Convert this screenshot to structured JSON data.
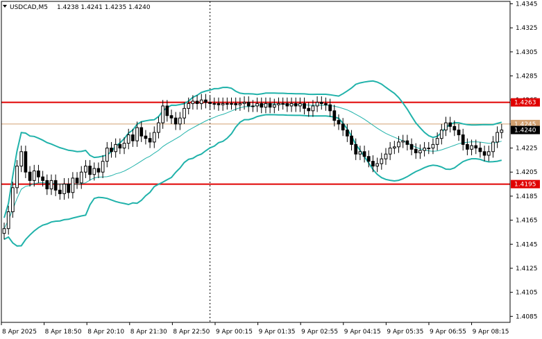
{
  "header": {
    "symbol": "USDCAD,M5",
    "ohlc": "1.4238 1.4241 1.4235 1.4240"
  },
  "colors": {
    "candle": "#000000",
    "band": "#20b2aa",
    "ma": "#20b2aa",
    "resistance": "#e00000",
    "current_line": "#d2a070",
    "axis": "#000000",
    "background": "#ffffff"
  },
  "chart_data": {
    "type": "candlestick",
    "symbol": "USDCAD",
    "timeframe": "M5",
    "ylim": [
      1.408,
      1.4347
    ],
    "y_ticks": [
      "1.4345",
      "1.4325",
      "1.4305",
      "1.4285",
      "1.4265",
      "1.4245",
      "1.4225",
      "1.4205",
      "1.4185",
      "1.4165",
      "1.4145",
      "1.4125",
      "1.4105",
      "1.4085"
    ],
    "x_ticks": [
      "8 Apr 2025",
      "8 Apr 18:50",
      "8 Apr 20:10",
      "8 Apr 21:30",
      "8 Apr 22:50",
      "9 Apr 00:15",
      "9 Apr 01:35",
      "9 Apr 02:55",
      "9 Apr 04:15",
      "9 Apr 05:35",
      "9 Apr 06:55",
      "9 Apr 08:15"
    ],
    "horizontal_levels": [
      {
        "value": 1.4263,
        "label": "1.4263",
        "color": "#e00000"
      },
      {
        "value": 1.4195,
        "label": "1.4195",
        "color": "#e00000"
      }
    ],
    "current_price": {
      "value": 1.424,
      "label": "1.4240"
    },
    "secondary_price": {
      "value": 1.4245,
      "label": "1.4245"
    },
    "vertical_marker_index": 48,
    "close": [
      1.4158,
      1.4172,
      1.4192,
      1.421,
      1.4222,
      1.4205,
      1.4198,
      1.4206,
      1.4201,
      1.4198,
      1.4191,
      1.4198,
      1.419,
      1.4187,
      1.4195,
      1.4188,
      1.42,
      1.4196,
      1.4205,
      1.421,
      1.4203,
      1.4208,
      1.4205,
      1.4214,
      1.4225,
      1.4222,
      1.4228,
      1.4225,
      1.4229,
      1.4236,
      1.4231,
      1.4242,
      1.4235,
      1.4233,
      1.423,
      1.4238,
      1.4246,
      1.426,
      1.4252,
      1.425,
      1.4245,
      1.425,
      1.4258,
      1.4262,
      1.4264,
      1.4262,
      1.4265,
      1.4263,
      1.4262,
      1.4262,
      1.4261,
      1.4262,
      1.4262,
      1.4262,
      1.4261,
      1.4262,
      1.4263,
      1.426,
      1.426,
      1.4262,
      1.4259,
      1.4262,
      1.4259,
      1.4261,
      1.4262,
      1.4262,
      1.426,
      1.4262,
      1.426,
      1.4262,
      1.4258,
      1.4256,
      1.426,
      1.4263,
      1.4262,
      1.4261,
      1.4256,
      1.4248,
      1.4245,
      1.424,
      1.4235,
      1.4228,
      1.422,
      1.4222,
      1.4218,
      1.4214,
      1.421,
      1.4212,
      1.4216,
      1.422,
      1.4225,
      1.4226,
      1.423,
      1.4231,
      1.4228,
      1.4224,
      1.4221,
      1.4223,
      1.4225,
      1.4225,
      1.4228,
      1.4233,
      1.424,
      1.4246,
      1.4243,
      1.424,
      1.4236,
      1.4228,
      1.4224,
      1.4227,
      1.4225,
      1.4222,
      1.4219,
      1.4222,
      1.423,
      1.4238,
      1.424
    ]
  }
}
